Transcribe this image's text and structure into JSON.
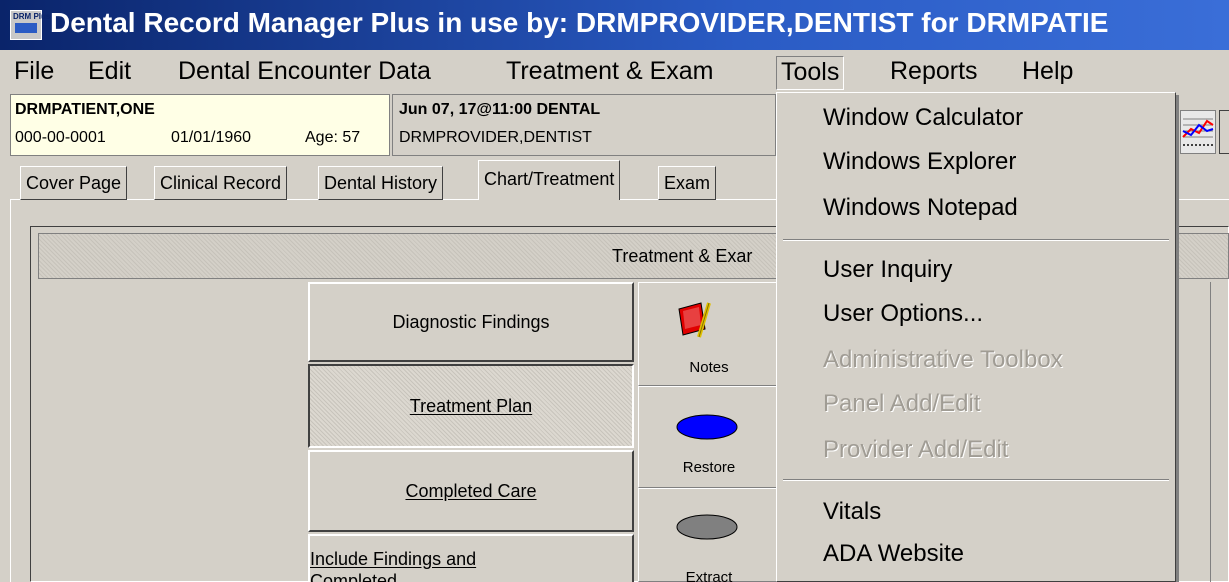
{
  "window": {
    "title": "Dental Record Manager Plus in use by: DRMPROVIDER,DENTIST for DRMPATIE",
    "icon_label": "DRM Plus"
  },
  "menubar": {
    "file": "File",
    "edit": "Edit",
    "dental_encounter": "Dental Encounter Data",
    "treatment_exam": "Treatment & Exam",
    "tools": "Tools",
    "reports": "Reports",
    "help": "Help"
  },
  "patient": {
    "name": "DRMPATIENT,ONE",
    "ssn": "000-00-0001",
    "dob": "01/01/1960",
    "age": "Age: 57"
  },
  "encounter": {
    "datetime": "Jun 07, 17@11:00 DENTAL",
    "provider": "DRMPROVIDER,DENTIST"
  },
  "tabs": [
    {
      "label": "Cover Page"
    },
    {
      "label": "Clinical Record"
    },
    {
      "label": "Dental History"
    },
    {
      "label": "Chart/Treatment",
      "active": true
    },
    {
      "label": "Exam"
    }
  ],
  "treatment_header": "Treatment & Exar",
  "side_buttons": {
    "diagnostic": "Diagnostic Findings",
    "treatment_plan": "Treatment Plan",
    "completed": "Completed Care",
    "include": "Include Findings and",
    "include2": "Completed"
  },
  "tools": {
    "notes": "Notes",
    "restore": "Restore",
    "extract": "Extract"
  },
  "tools_menu": {
    "window_calculator": "Window Calculator",
    "windows_explorer": "Windows Explorer",
    "windows_notepad": "Windows Notepad",
    "user_inquiry": "User Inquiry",
    "user_options": "User Options...",
    "admin_toolbox": "Administrative Toolbox",
    "panel_add_edit": "Panel Add/Edit",
    "provider_add_edit": "Provider Add/Edit",
    "vitals": "Vitals",
    "ada_website": "ADA Website"
  },
  "colors": {
    "title_bar": "#0a246a",
    "window_bg": "#d4d0c8",
    "patient_bg": "#ffffe6",
    "restore_blue": "#0000ff",
    "extract_gray": "#808080"
  }
}
